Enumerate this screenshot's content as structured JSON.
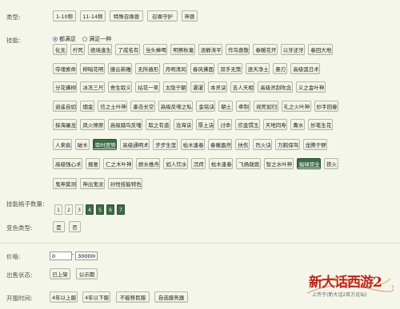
{
  "labels": {
    "type": "类型:",
    "skills": "技能:",
    "slots": "技能格子数量:",
    "variant": "变色类型:",
    "price": "价格:",
    "sale_status": "出售状态:",
    "server_time": "开服时间:"
  },
  "type_buttons": [
    "1-10称",
    "11-14称",
    "特殊召唤兽",
    "召唤守护",
    "神兽"
  ],
  "skill_mode": {
    "options": [
      "都满足",
      "满足一种"
    ],
    "selected": 0
  },
  "skill_rows": [
    [
      "化无",
      "柠死",
      "绝境逢生",
      "了成名有",
      "当头棒喝",
      "明察秋毫",
      "浪静涛平",
      "作鸟兽散",
      "春暖花开",
      "以牙还牙",
      "春回大地"
    ],
    [
      "夺魂索命",
      "柳暗花明",
      "撞云新雕",
      "无所遁形",
      "月明清风",
      "春风拂面",
      "双手无策",
      "逐天净土",
      "悬刃",
      "高级弧日术"
    ],
    [
      "分花拂柳",
      "冰冻三尺",
      "舍生取义",
      "拈花一笑",
      "太隐于朝",
      "濯濯",
      "本灵诀",
      "吉人天相",
      "高级灵刮吹念",
      "义之金叶神"
    ],
    [
      "逍遥自如",
      "烟金",
      "信之土叶神",
      "墨击长空",
      "高级反噬之私",
      "金铭诀",
      "朝土",
      "牵制",
      "视死如归",
      "礼之火叶神",
      "妙手回春"
    ],
    [
      "探海屠龙",
      "凤火燎原",
      "高级踏鸟反唾",
      "取之有道",
      "沧海诀",
      "厚土诀",
      "讨命",
      "炊金馔玉",
      "天地同寿",
      "膺水",
      "妙笔生花"
    ],
    [
      "人来疯",
      "破木",
      "审时度势",
      "高级通明术",
      "步步生莲",
      "枯木逢春",
      "春暖盎然",
      "扶伤",
      "烈火诀",
      "万鹤保驾",
      "龙腾于野"
    ],
    [
      "高级强心术",
      "报复",
      "仁之木叶神",
      "顾水推舟",
      "如人饮水",
      "沉疴",
      "枯木逢春",
      "飞扬跋扈",
      "智之水叶神",
      "福禄双全",
      "铁火"
    ],
    [
      "鬼神莫测",
      "神出鬼没",
      "孙悟技能特色"
    ]
  ],
  "selected_skills": [
    "审时度势",
    "福禄双全"
  ],
  "slot_counts": [
    "1",
    "2",
    "3",
    "4",
    "5",
    "6",
    "7"
  ],
  "selected_slots": [
    "4",
    "5",
    "6",
    "7"
  ],
  "variant_buttons": [
    "是",
    "否"
  ],
  "price": {
    "min": "0",
    "max": "300000",
    "separator": "-"
  },
  "sale_status_buttons": [
    "已上架",
    "公示期"
  ],
  "server_time_buttons": [
    "4年以上服",
    "4年以下服",
    "不能移民服",
    "自选服务器"
  ],
  "logo": {
    "main": "新大话西游2",
    "sub": "上传于(新大话2官方论坛)"
  },
  "colors": {
    "selected": "#3e6b47",
    "background": "#f3f6e9",
    "logo_red": "#c0261f"
  }
}
